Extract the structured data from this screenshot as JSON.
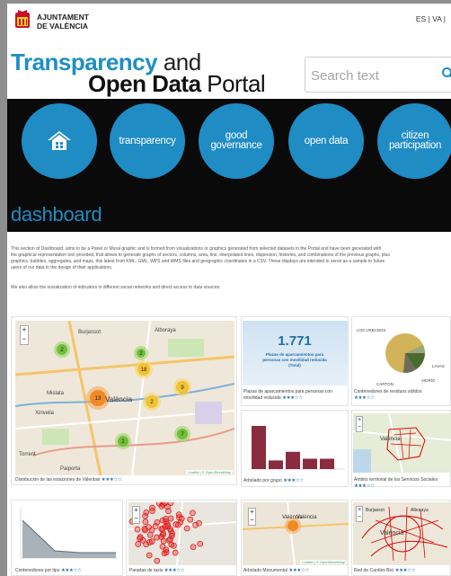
{
  "header": {
    "city_line1": "AJUNTAMENT",
    "city_line2": "DE VALÈNCIA",
    "lang_es": "ES",
    "lang_sep": "|",
    "lang_va": "VA |"
  },
  "title": {
    "transparency": "Transparency",
    "and": " and",
    "open_data": "Open Data",
    "portal": " Portal"
  },
  "search": {
    "placeholder": "Search text"
  },
  "nav": {
    "items": [
      {
        "label": "home"
      },
      {
        "label": "transparency"
      },
      {
        "label": "good governance"
      },
      {
        "label": "open data"
      },
      {
        "label_line1": "citizen",
        "label_line2": "participation"
      }
    ]
  },
  "page_heading": "dashboard",
  "intro": {
    "line1": "This section of Dashboard, aims to be a Panel or Mural graphic and is formed from visualizations or graphics generated from selected datasets in the Portal and have been generated with",
    "line2": "the graphical representation tool provided, that allows to generate graphs of sectors, columns, area, line, interpolated lines, dispersion, histories, and combinations of the previous graphs, plus",
    "line3": "graphics, bubbles, aggregates, and maps, this latest from KML, GML, WPS and WMS files and geographic coordinates in a CSV. These displays are intended to serve as a sample to future",
    "line4": "users of our data in the design of their applications.",
    "line5": "We also allow the socialization of indicators in different social networks and direct access to data sources."
  },
  "tiles": {
    "t1": {
      "caption": "Distribución de las estaciones de Valenbisi",
      "stars": "★★★☆☆"
    },
    "t2": {
      "caption_line1": "Plazas de aparcamientos para personas con",
      "caption_line2": "movilidad reducida",
      "stars": "★★★☆☆",
      "big_value": "1.771",
      "sub1": "Plazas de aparcamientos para",
      "sub2": "personas con movilidad reducida",
      "sub3": "(Total)"
    },
    "t3": {
      "caption": "Contenedores de residuos sólidos",
      "stars": "★★★☆☆",
      "lbl_a": "LOS URBANOS",
      "lbl_b": "LAVAS",
      "lbl_c": "VIDRIO",
      "lbl_d": "CARTÓN"
    },
    "t4": {
      "caption": "Arbolado por grupo",
      "stars": "★★★☆☆"
    },
    "t5": {
      "caption": "Ámbito territorial de los Servicios Sociales",
      "stars": "★★★☆☆"
    },
    "t6": {
      "caption": "Contenedores por tipo",
      "stars": "★★★☆☆"
    },
    "t7": {
      "caption": "Paradas de taxis",
      "stars": "★★★☆☆"
    },
    "t8": {
      "caption": "Arbolado Monumental",
      "stars": "★★★☆☆"
    },
    "t9": {
      "caption": "Red de Carriles Bici",
      "stars": "★★★☆☆"
    }
  },
  "map_labels": {
    "burjassot": "Burjassot",
    "valencia": "València",
    "alboraya": "Alboraya",
    "mislata": "Mislata",
    "xirivella": "Xirivella",
    "torrent": "Torrent",
    "paiporta": "Paiporta",
    "attribution": "Leaflet | © OpenStreetMap",
    "zoom_in": "+",
    "zoom_out": "−",
    "cluster_values": [
      "2",
      "18",
      "13",
      "2",
      "9",
      "7",
      "2",
      "2"
    ]
  },
  "colors": {
    "accent": "#1f8cc4",
    "nav_band": "#0a0a0a",
    "bar": "#8b2b3f",
    "pie": [
      "#d3b35a",
      "#4a6b2f",
      "#6d6d5a",
      "#9aa87a"
    ]
  },
  "bars": {
    "values": [
      5,
      1,
      2,
      1.2,
      1.2
    ]
  }
}
